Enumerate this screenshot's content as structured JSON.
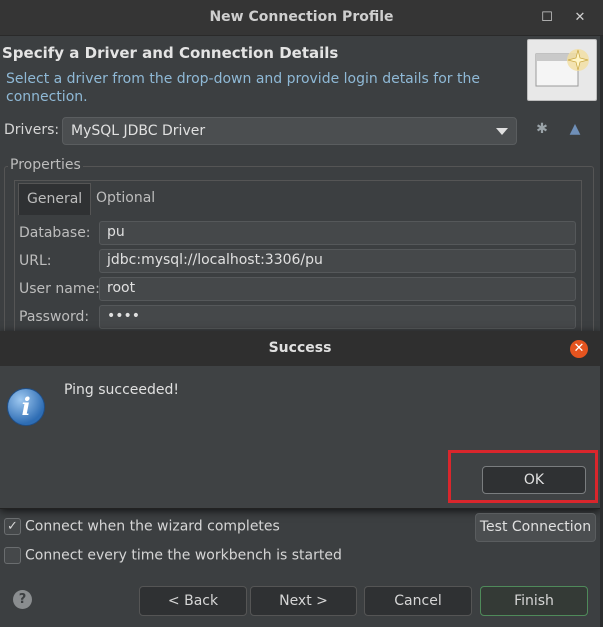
{
  "window": {
    "title": "New Connection Profile"
  },
  "header": {
    "title": "Specify a Driver and Connection Details",
    "description": "Select a driver from the drop-down and provide login details for the connection."
  },
  "drivers": {
    "label": "Drivers:",
    "selected": "MySQL JDBC Driver"
  },
  "properties": {
    "group_label": "Properties",
    "tabs": [
      {
        "label": "General"
      },
      {
        "label": "Optional"
      }
    ],
    "fields": {
      "database": {
        "label": "Database:",
        "value": "pu"
      },
      "url": {
        "label": "URL:",
        "value": "jdbc:mysql://localhost:3306/pu"
      },
      "username": {
        "label": "User name:",
        "value": "root"
      },
      "password": {
        "label": "Password:",
        "value": "••••"
      }
    }
  },
  "dialog": {
    "title": "Success",
    "message": "Ping succeeded!",
    "ok_label": "OK",
    "icon": "info-icon"
  },
  "options": {
    "connect_on_complete": {
      "label": "Connect when the wizard completes",
      "checked": true
    },
    "connect_every_time": {
      "label": "Connect every time the workbench is started",
      "checked": false
    }
  },
  "test_connection_label": "Test Connection",
  "footer": {
    "back": "< Back",
    "next": "Next >",
    "cancel": "Cancel",
    "finish": "Finish"
  },
  "colors": {
    "accent_red": "#d9262c",
    "close_orange": "#e5541f",
    "description_blue": "#8fb9d6"
  }
}
